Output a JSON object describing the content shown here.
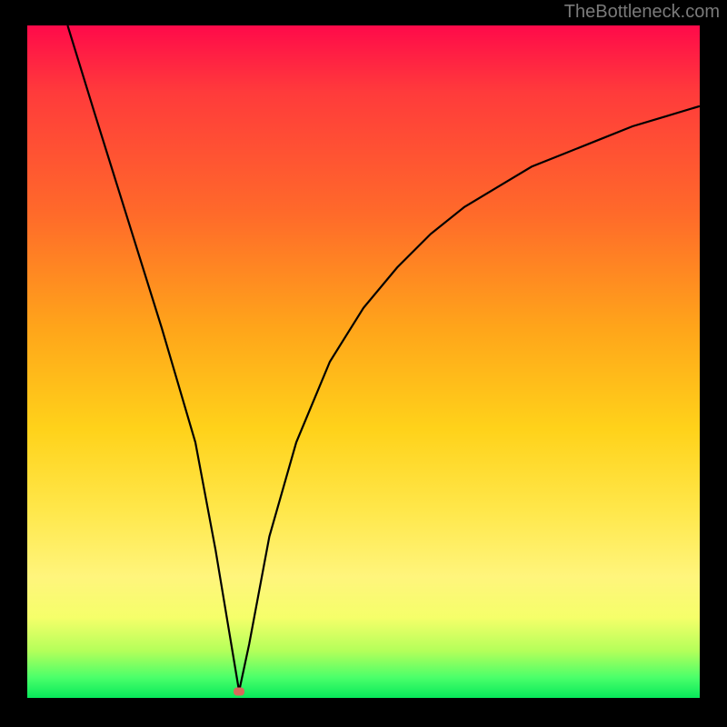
{
  "watermark": "TheBottleneck.com",
  "chart_data": {
    "type": "line",
    "title": "",
    "xlabel": "",
    "ylabel": "",
    "xlim": [
      0,
      100
    ],
    "ylim": [
      0,
      100
    ],
    "series": [
      {
        "name": "bottleneck-curve",
        "x": [
          6,
          10,
          15,
          20,
          25,
          28,
          30,
          31.5,
          33,
          36,
          40,
          45,
          50,
          55,
          60,
          65,
          70,
          75,
          80,
          85,
          90,
          95,
          100
        ],
        "values": [
          100,
          87,
          71,
          55,
          38,
          22,
          10,
          1,
          8,
          24,
          38,
          50,
          58,
          64,
          69,
          73,
          76,
          79,
          81,
          83,
          85,
          86.5,
          88
        ]
      }
    ],
    "marker": {
      "x": 31.5,
      "y": 1
    },
    "grid": false,
    "legend": false
  },
  "colors": {
    "background": "#000000",
    "curve": "#000000",
    "marker": "#d66a5a"
  }
}
